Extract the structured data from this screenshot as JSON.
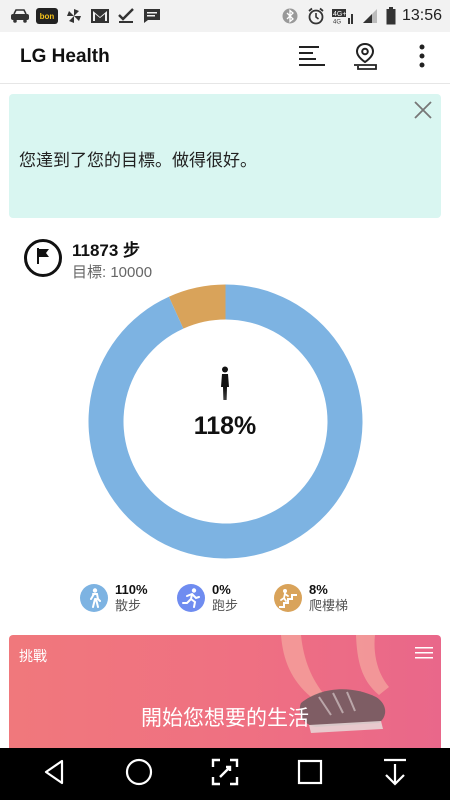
{
  "status_bar": {
    "time": "13:56",
    "left_icons": [
      "car-icon",
      "bon-app-icon",
      "pinwheel-icon",
      "gmail-icon",
      "checkmark-icon",
      "message-icon"
    ],
    "bon_label": "bon",
    "right_icons": [
      "bluetooth-icon",
      "alarm-icon",
      "lte-4g-icon",
      "signal-icon",
      "battery-icon"
    ],
    "network_label": "4G+"
  },
  "app_bar": {
    "title": "LG Health",
    "actions": [
      "list-menu-icon",
      "location-pin-icon",
      "overflow-menu-icon"
    ]
  },
  "goal_banner": {
    "message": "您達到了您的目標。做得很好。",
    "close_icon": "close-icon",
    "background": "#d9f6f1"
  },
  "steps": {
    "summary": "11873 步",
    "goal": "目標: 10000",
    "percent": "118%"
  },
  "chart_data": {
    "type": "pie",
    "style": "donut",
    "categories": [
      "散步",
      "跑步",
      "爬樓梯"
    ],
    "values": [
      110,
      0,
      8
    ],
    "colors": [
      "#7db3e2",
      "#6f8cf0",
      "#d9a35a"
    ]
  },
  "legend": [
    {
      "value": "110%",
      "label": "散步",
      "color": "#7db3e2",
      "icon": "walking-icon"
    },
    {
      "value": "0%",
      "label": "跑步",
      "color": "#6f8cf0",
      "icon": "running-icon"
    },
    {
      "value": "8%",
      "label": "爬樓梯",
      "color": "#d9a35a",
      "icon": "stairs-icon"
    }
  ],
  "challenge": {
    "label": "挑戰",
    "title": "開始您想要的生活",
    "menu_icon": "hamburger-menu-icon"
  },
  "nav_bar": {
    "buttons": [
      "back-icon",
      "home-icon",
      "capture-icon",
      "recents-icon",
      "notification-pull-icon"
    ]
  },
  "colors": {
    "walk": "#7db3e2",
    "run": "#6f8cf0",
    "stairs": "#d9a35a",
    "challenge_bg": "#ef7082"
  }
}
